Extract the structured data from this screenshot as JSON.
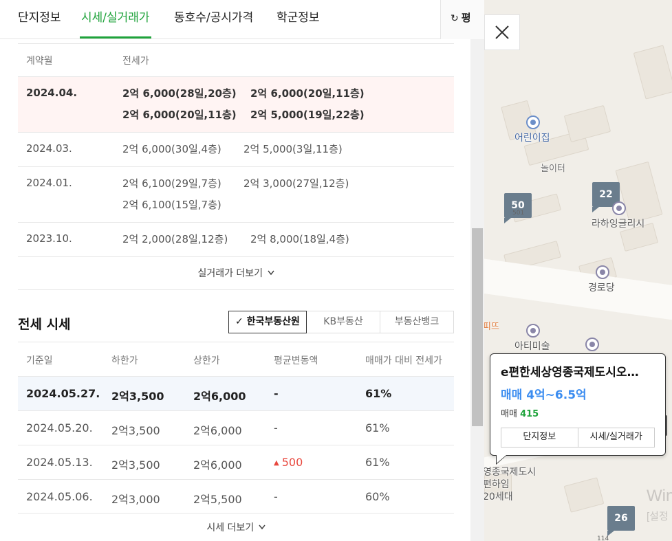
{
  "tabs": [
    "단지정보",
    "시세/실거래가",
    "동호수/공시가격",
    "학군정보"
  ],
  "active_tab": 1,
  "pyeong_toggle": {
    "icon": "↻",
    "label": "평"
  },
  "jeonse_transactions": {
    "headers": {
      "month": "계약월",
      "price": "전세가"
    },
    "rows": [
      {
        "month": "2024.04.",
        "highlight": true,
        "deals": [
          "2억 6,000(28일,20층)",
          "2억 6,000(20일,11층)",
          "2억 6,000(20일,11층)",
          "2억 5,000(19일,22층)"
        ]
      },
      {
        "month": "2024.03.",
        "highlight": false,
        "deals": [
          "2억 6,000(30일,4층)",
          "2억 5,000(3일,11층)"
        ]
      },
      {
        "month": "2024.01.",
        "highlight": false,
        "deals": [
          "2억 6,100(29일,7층)",
          "2억 3,000(27일,12층)",
          "2억 6,100(15일,7층)"
        ]
      },
      {
        "month": "2023.10.",
        "highlight": false,
        "deals": [
          "2억 2,000(28일,12층)",
          "2억 8,000(18일,4층)"
        ]
      }
    ],
    "more_label": "실거래가 더보기",
    "more_icon": "chevron-down"
  },
  "jeonse_price": {
    "title": "전세 시세",
    "sources": [
      {
        "label": "한국부동산원",
        "selected": true,
        "check": "✓"
      },
      {
        "label": "KB부동산",
        "selected": false
      },
      {
        "label": "부동산뱅크",
        "selected": false
      }
    ],
    "headers": [
      "기준일",
      "하한가",
      "상한가",
      "평균변동액",
      "매매가 대비 전세가"
    ],
    "rows": [
      {
        "date": "2024.05.27.",
        "low": "2억3,500",
        "high": "2억6,000",
        "change": "-",
        "ratio": "61%",
        "highlight": true,
        "change_up": false
      },
      {
        "date": "2024.05.20.",
        "low": "2억3,500",
        "high": "2억6,000",
        "change": "-",
        "ratio": "61%",
        "highlight": false,
        "change_up": false
      },
      {
        "date": "2024.05.13.",
        "low": "2억3,500",
        "high": "2억6,000",
        "change": "500",
        "ratio": "61%",
        "highlight": false,
        "change_up": true
      },
      {
        "date": "2024.05.06.",
        "low": "2억3,000",
        "high": "2억5,500",
        "change": "-",
        "ratio": "60%",
        "highlight": false,
        "change_up": false
      }
    ],
    "more_label": "시세 더보기"
  },
  "map": {
    "labels": {
      "daycare": "어린이집",
      "playground": "놀이터",
      "lahaing": "라하잉글리시",
      "senior": "경로당",
      "art": "아티미술",
      "edge_orange": "피뜨",
      "complex_1": "영종국제도시",
      "complex_2": "편하임",
      "complex_3": "20세대",
      "wm_1": "Win",
      "wm_2": "[설정"
    },
    "markers": [
      {
        "count": "50",
        "sub": "501"
      },
      {
        "count": "22"
      },
      {
        "count": "26",
        "sub": "114"
      }
    ]
  },
  "popup": {
    "title": "e편한세상영종국제도시오…",
    "price": "매매 4억~6.5억",
    "count_label": "매매",
    "count_value": "415",
    "buttons": [
      "단지정보",
      "시세/실거래가"
    ]
  },
  "colors": {
    "accent_green": "#1fa33b",
    "price_blue": "#3c8df0",
    "up_red": "#e8483e",
    "highlight_pink": "#fff4f3",
    "highlight_blue": "#f3f7fc"
  }
}
